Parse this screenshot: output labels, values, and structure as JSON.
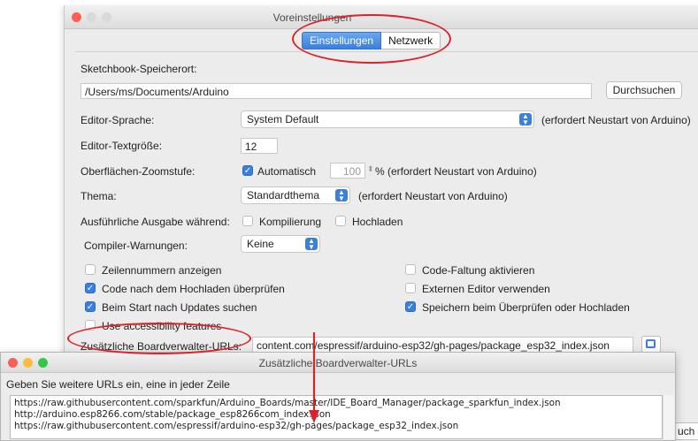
{
  "window": {
    "title": "Voreinstellungen",
    "tabs": [
      {
        "label": "Einstellungen",
        "active": true
      },
      {
        "label": "Netzwerk",
        "active": false
      }
    ]
  },
  "settings": {
    "sketchbook_label": "Sketchbook-Speicherort:",
    "sketchbook_path": "/Users/ms/Documents/Arduino",
    "browse_button": "Durchsuchen",
    "editor_language_label": "Editor-Sprache:",
    "editor_language_value": "System Default",
    "editor_language_note": "(erfordert Neustart von Arduino)",
    "editor_textsize_label": "Editor-Textgröße:",
    "editor_textsize_value": "12",
    "zoom_label": "Oberflächen-Zoomstufe:",
    "zoom_auto_label": "Automatisch",
    "zoom_auto_checked": true,
    "zoom_value": "100",
    "zoom_unit": "%",
    "zoom_note": "(erfordert Neustart von Arduino)",
    "theme_label": "Thema:",
    "theme_value": "Standardthema",
    "theme_note": "(erfordert Neustart von Arduino)",
    "verbose_label": "Ausführliche Ausgabe während:",
    "verbose_compile_label": "Kompilierung",
    "verbose_compile_checked": false,
    "verbose_upload_label": "Hochladen",
    "verbose_upload_checked": false,
    "warnings_label": "Compiler-Warnungen:",
    "warnings_value": "Keine",
    "options_left": [
      {
        "label": "Zeilennummern anzeigen",
        "checked": false
      },
      {
        "label": "Code nach dem Hochladen überprüfen",
        "checked": true
      },
      {
        "label": "Beim Start nach Updates suchen",
        "checked": true
      },
      {
        "label": "Use accessibility features",
        "checked": false
      }
    ],
    "options_right": [
      {
        "label": "Code-Faltung aktivieren",
        "checked": false
      },
      {
        "label": "Externen Editor verwenden",
        "checked": false
      },
      {
        "label": "Speichern beim Überprüfen oder Hochladen",
        "checked": true
      }
    ],
    "board_urls_label": "Zusätzliche Boardverwalter-URLs:",
    "board_urls_value": "content.com/espressif/arduino-esp32/gh-pages/package_esp32_index.json",
    "partial_button": "uch"
  },
  "dialog": {
    "title": "Zusätzliche Boardverwalter-URLs",
    "instruction": "Geben Sie weitere URLs ein, eine in jeder Zeile",
    "urls": [
      "https://raw.githubusercontent.com/sparkfun/Arduino_Boards/master/IDE_Board_Manager/package_sparkfun_index.json",
      "http://arduino.esp8266.com/stable/package_esp8266com_index.json",
      "https://raw.githubusercontent.com/espressif/arduino-esp32/gh-pages/package_esp32_index.json"
    ]
  },
  "colors": {
    "accent": "#3b7fdc",
    "close": "#fc5f57",
    "annotation": "#d9232a"
  }
}
